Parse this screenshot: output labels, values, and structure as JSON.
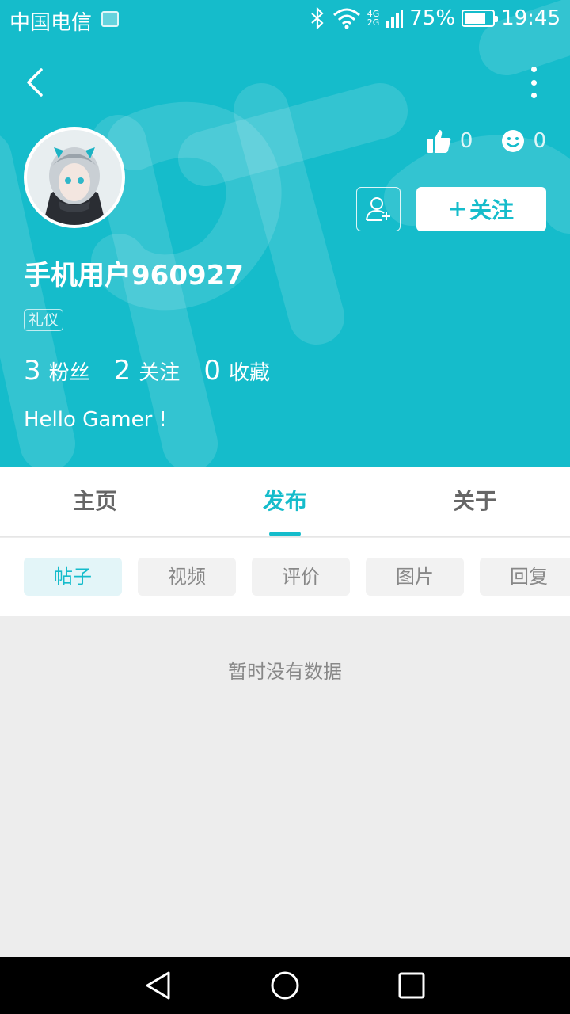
{
  "status_bar": {
    "carrier": "中国电信",
    "network_top": "4G",
    "network_bottom": "2G",
    "battery": "75%",
    "battery_level": 0.75,
    "time": "19:45"
  },
  "profile": {
    "likes": "0",
    "emoji_count": "0",
    "follow_label": "关注",
    "username": "手机用户960927",
    "badge": "礼仪",
    "fans_count": "3",
    "fans_label": "粉丝",
    "following_count": "2",
    "following_label": "关注",
    "favorites_count": "0",
    "favorites_label": "收藏",
    "bio": "Hello Gamer !"
  },
  "tabs": [
    {
      "label": "主页"
    },
    {
      "label": "发布"
    },
    {
      "label": "关于"
    }
  ],
  "filters": [
    {
      "label": "帖子"
    },
    {
      "label": "视频"
    },
    {
      "label": "评价"
    },
    {
      "label": "图片"
    },
    {
      "label": "回复"
    }
  ],
  "empty_state": "暂时没有数据",
  "colors": {
    "accent": "#15bccb",
    "header_bg": "#15bccb",
    "page_bg": "#ededed"
  }
}
